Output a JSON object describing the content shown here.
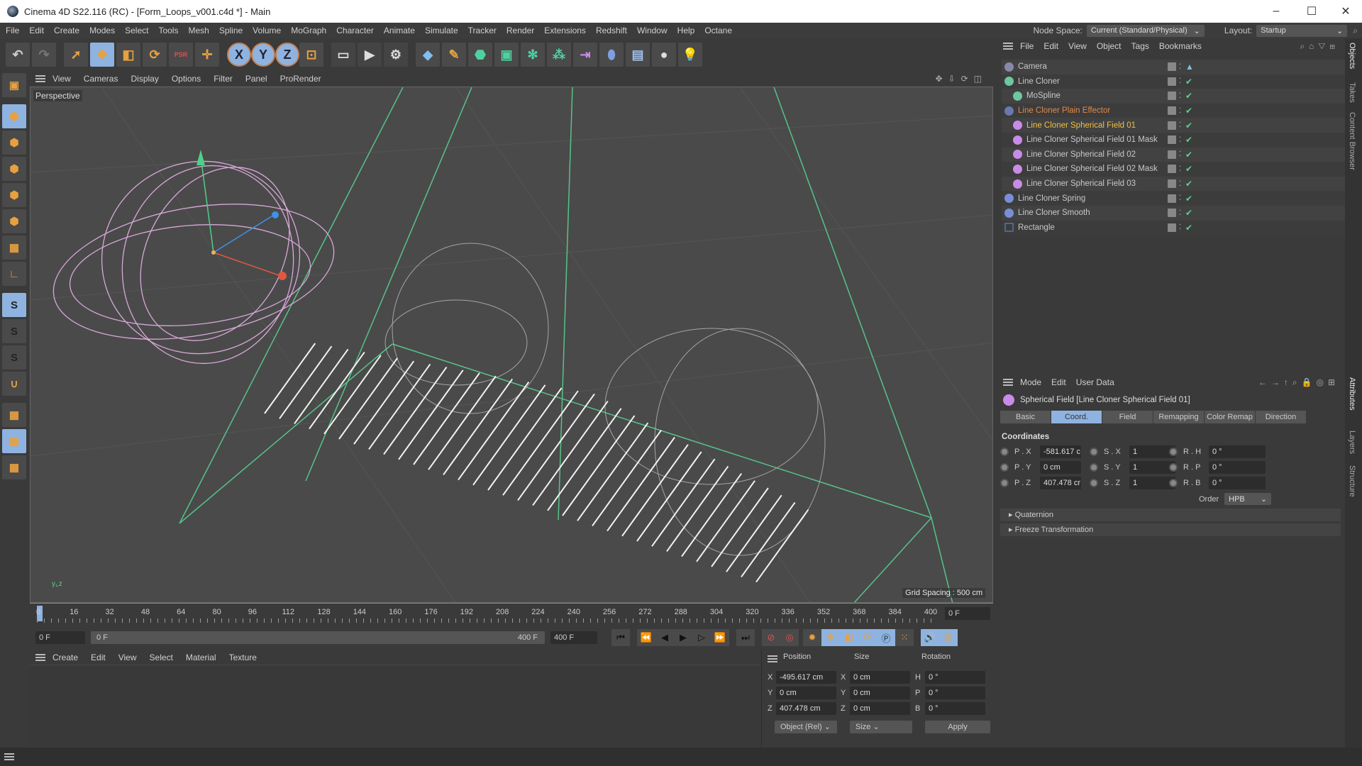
{
  "window": {
    "title": "Cinema 4D S22.116 (RC) - [Form_Loops_v001.c4d *] - Main",
    "controls": {
      "minimize": "–",
      "maximize": "☐",
      "close": "✕"
    }
  },
  "menubar": {
    "items": [
      "File",
      "Edit",
      "Create",
      "Modes",
      "Select",
      "Tools",
      "Mesh",
      "Spline",
      "Volume",
      "MoGraph",
      "Character",
      "Animate",
      "Simulate",
      "Tracker",
      "Render",
      "Extensions",
      "Redshift",
      "Window",
      "Help",
      "Octane"
    ],
    "node_space_label": "Node Space:",
    "node_space_value": "Current (Standard/Physical)",
    "layout_label": "Layout:",
    "layout_value": "Startup"
  },
  "toolbar": {
    "undo": "↶",
    "redo": "↷",
    "tools": [
      {
        "icon": "live-selection-icon",
        "glyph": "➚",
        "selected": false
      },
      {
        "icon": "move-icon",
        "glyph": "✥",
        "selected": true
      },
      {
        "icon": "scale-icon",
        "glyph": "◧",
        "selected": false
      },
      {
        "icon": "rotate-icon",
        "glyph": "⟳",
        "selected": false
      },
      {
        "icon": "psr-icon",
        "glyph": "PSR",
        "selected": false
      },
      {
        "icon": "axis-move-icon",
        "glyph": "✛",
        "selected": false
      }
    ],
    "axes": [
      {
        "label": "X"
      },
      {
        "label": "Y"
      },
      {
        "label": "Z"
      }
    ],
    "coordinate_system_glyph": "⊡"
  },
  "palette": {
    "items": [
      {
        "name": "make-editable",
        "glyph": "▣",
        "selected": false
      },
      {
        "name": "model-mode",
        "glyph": "⬢",
        "selected": true
      },
      {
        "name": "texture-mode",
        "glyph": "⬢",
        "selected": false
      },
      {
        "name": "points-mode",
        "glyph": "⬢",
        "selected": false
      },
      {
        "name": "edges-mode",
        "glyph": "⬢",
        "selected": false
      },
      {
        "name": "polygons-mode",
        "glyph": "⬢",
        "selected": false
      },
      {
        "name": "uv-mode",
        "glyph": "▦",
        "selected": false
      },
      {
        "name": "axis-mode",
        "glyph": "∟",
        "selected": false
      },
      {
        "name": "snap-solo",
        "glyph": "S",
        "selected": true
      },
      {
        "name": "snap-solo-hierarchy",
        "glyph": "S",
        "selected": false
      },
      {
        "name": "snap-solo-off",
        "glyph": "S",
        "selected": false
      },
      {
        "name": "snap-magnet",
        "glyph": "∪",
        "selected": false
      },
      {
        "name": "workplane",
        "glyph": "▦",
        "selected": false
      },
      {
        "name": "locked-workplane",
        "glyph": "▦",
        "selected": true
      },
      {
        "name": "workplane-align",
        "glyph": "▦",
        "selected": false
      }
    ]
  },
  "viewport": {
    "menu": [
      "View",
      "Cameras",
      "Display",
      "Options",
      "Filter",
      "Panel",
      "ProRender"
    ],
    "label": "Perspective",
    "grid_spacing": "Grid Spacing : 500 cm"
  },
  "timeline": {
    "ticks": [
      "0",
      "16",
      "32",
      "48",
      "64",
      "80",
      "96",
      "112",
      "128",
      "144",
      "160",
      "176",
      "192",
      "208",
      "224",
      "240",
      "256",
      "272",
      "288",
      "304",
      "320",
      "336",
      "352",
      "368",
      "384",
      "400"
    ],
    "current_frame": "0 F",
    "start_field": "0 F",
    "range_start": "0 F",
    "range_end": "400 F",
    "end_field": "400 F"
  },
  "material_manager": {
    "menu": [
      "Create",
      "Edit",
      "View",
      "Select",
      "Material",
      "Texture"
    ]
  },
  "coordinates": {
    "headers": {
      "position": "Position",
      "size": "Size",
      "rotation": "Rotation"
    },
    "rows": [
      {
        "axis": "X",
        "pos": "-495.617 cm",
        "size_axis": "X",
        "size": "0 cm",
        "rot_axis": "H",
        "rot": "0 °"
      },
      {
        "axis": "Y",
        "pos": "0 cm",
        "size_axis": "Y",
        "size": "0 cm",
        "rot_axis": "P",
        "rot": "0 °"
      },
      {
        "axis": "Z",
        "pos": "407.478 cm",
        "size_axis": "Z",
        "size": "0 cm",
        "rot_axis": "B",
        "rot": "0 °"
      }
    ],
    "mode_select": "Object (Rel)",
    "size_select": "Size",
    "apply": "Apply"
  },
  "object_manager": {
    "menu": [
      "File",
      "Edit",
      "View",
      "Object",
      "Tags",
      "Bookmarks"
    ],
    "objects": [
      {
        "name": "Camera",
        "indent": 0,
        "color": "#c8c8c8",
        "icon_color": "#88a",
        "has_check": false
      },
      {
        "name": "Line Cloner",
        "indent": 0,
        "color": "#c8c8c8",
        "icon_color": "#6dc7a0",
        "has_check": true
      },
      {
        "name": "MoSpline",
        "indent": 1,
        "color": "#c8c8c8",
        "icon_color": "#6dc7a0",
        "has_check": true
      },
      {
        "name": "Line Cloner Plain Effector",
        "indent": 0,
        "color": "#e0894a",
        "icon_color": "#6a78b0",
        "has_check": true
      },
      {
        "name": "Line Cloner Spherical Field 01",
        "indent": 1,
        "color": "#f0c040",
        "icon_color": "#c98be8",
        "has_check": true
      },
      {
        "name": "Line Cloner Spherical Field 01 Mask",
        "indent": 1,
        "color": "#c8c8c8",
        "icon_color": "#c98be8",
        "has_check": true
      },
      {
        "name": "Line Cloner Spherical Field 02",
        "indent": 1,
        "color": "#c8c8c8",
        "icon_color": "#c98be8",
        "has_check": true
      },
      {
        "name": "Line Cloner Spherical Field 02 Mask",
        "indent": 1,
        "color": "#c8c8c8",
        "icon_color": "#c98be8",
        "has_check": true
      },
      {
        "name": "Line Cloner Spherical Field 03",
        "indent": 1,
        "color": "#c8c8c8",
        "icon_color": "#c98be8",
        "has_check": true
      },
      {
        "name": "Line Cloner Spring",
        "indent": 0,
        "color": "#c8c8c8",
        "icon_color": "#7a8ed8",
        "has_check": true
      },
      {
        "name": "Line Cloner Smooth",
        "indent": 0,
        "color": "#c8c8c8",
        "icon_color": "#7a8ed8",
        "has_check": true
      },
      {
        "name": "Rectangle",
        "indent": 0,
        "color": "#c8c8c8",
        "icon_color": "#4a6a90",
        "has_check": true
      }
    ]
  },
  "attributes": {
    "menu": [
      "Mode",
      "Edit",
      "User Data"
    ],
    "title": "Spherical Field [Line Cloner Spherical Field 01]",
    "tabs": [
      {
        "label": "Basic",
        "active": false
      },
      {
        "label": "Coord.",
        "active": true
      },
      {
        "label": "Field",
        "active": false
      },
      {
        "label": "Remapping",
        "active": false
      },
      {
        "label": "Color Remap",
        "active": false
      },
      {
        "label": "Direction",
        "active": false
      }
    ],
    "section": "Coordinates",
    "params": [
      {
        "p_label": "P . X",
        "p_val": "-581.617 c",
        "s_label": "S . X",
        "s_val": "1",
        "r_label": "R . H",
        "r_val": "0 °"
      },
      {
        "p_label": "P . Y",
        "p_val": "0 cm",
        "s_label": "S . Y",
        "s_val": "1",
        "r_label": "R . P",
        "r_val": "0 °"
      },
      {
        "p_label": "P . Z",
        "p_val": "407.478 cr",
        "s_label": "S . Z",
        "s_val": "1",
        "r_label": "R . B",
        "r_val": "0 °"
      }
    ],
    "order_label": "Order",
    "order_value": "HPB",
    "folds": [
      "Quaternion",
      "Freeze Transformation"
    ]
  },
  "side_tabs": {
    "top": [
      {
        "label": "Objects",
        "active": true
      },
      {
        "label": "Takes",
        "active": false
      },
      {
        "label": "Content Browser",
        "active": false
      }
    ],
    "bottom": [
      {
        "label": "Attributes",
        "active": true
      },
      {
        "label": "Layers",
        "active": false
      },
      {
        "label": "Structure",
        "active": false
      }
    ]
  },
  "colors": {
    "selection_blue": "#8fb3e0",
    "accent_orange": "#e8a040",
    "field_purple": "#c98be8",
    "active_object": "#f0c040",
    "effector_orange": "#e0894a",
    "enabled_green": "#5fd08f"
  }
}
